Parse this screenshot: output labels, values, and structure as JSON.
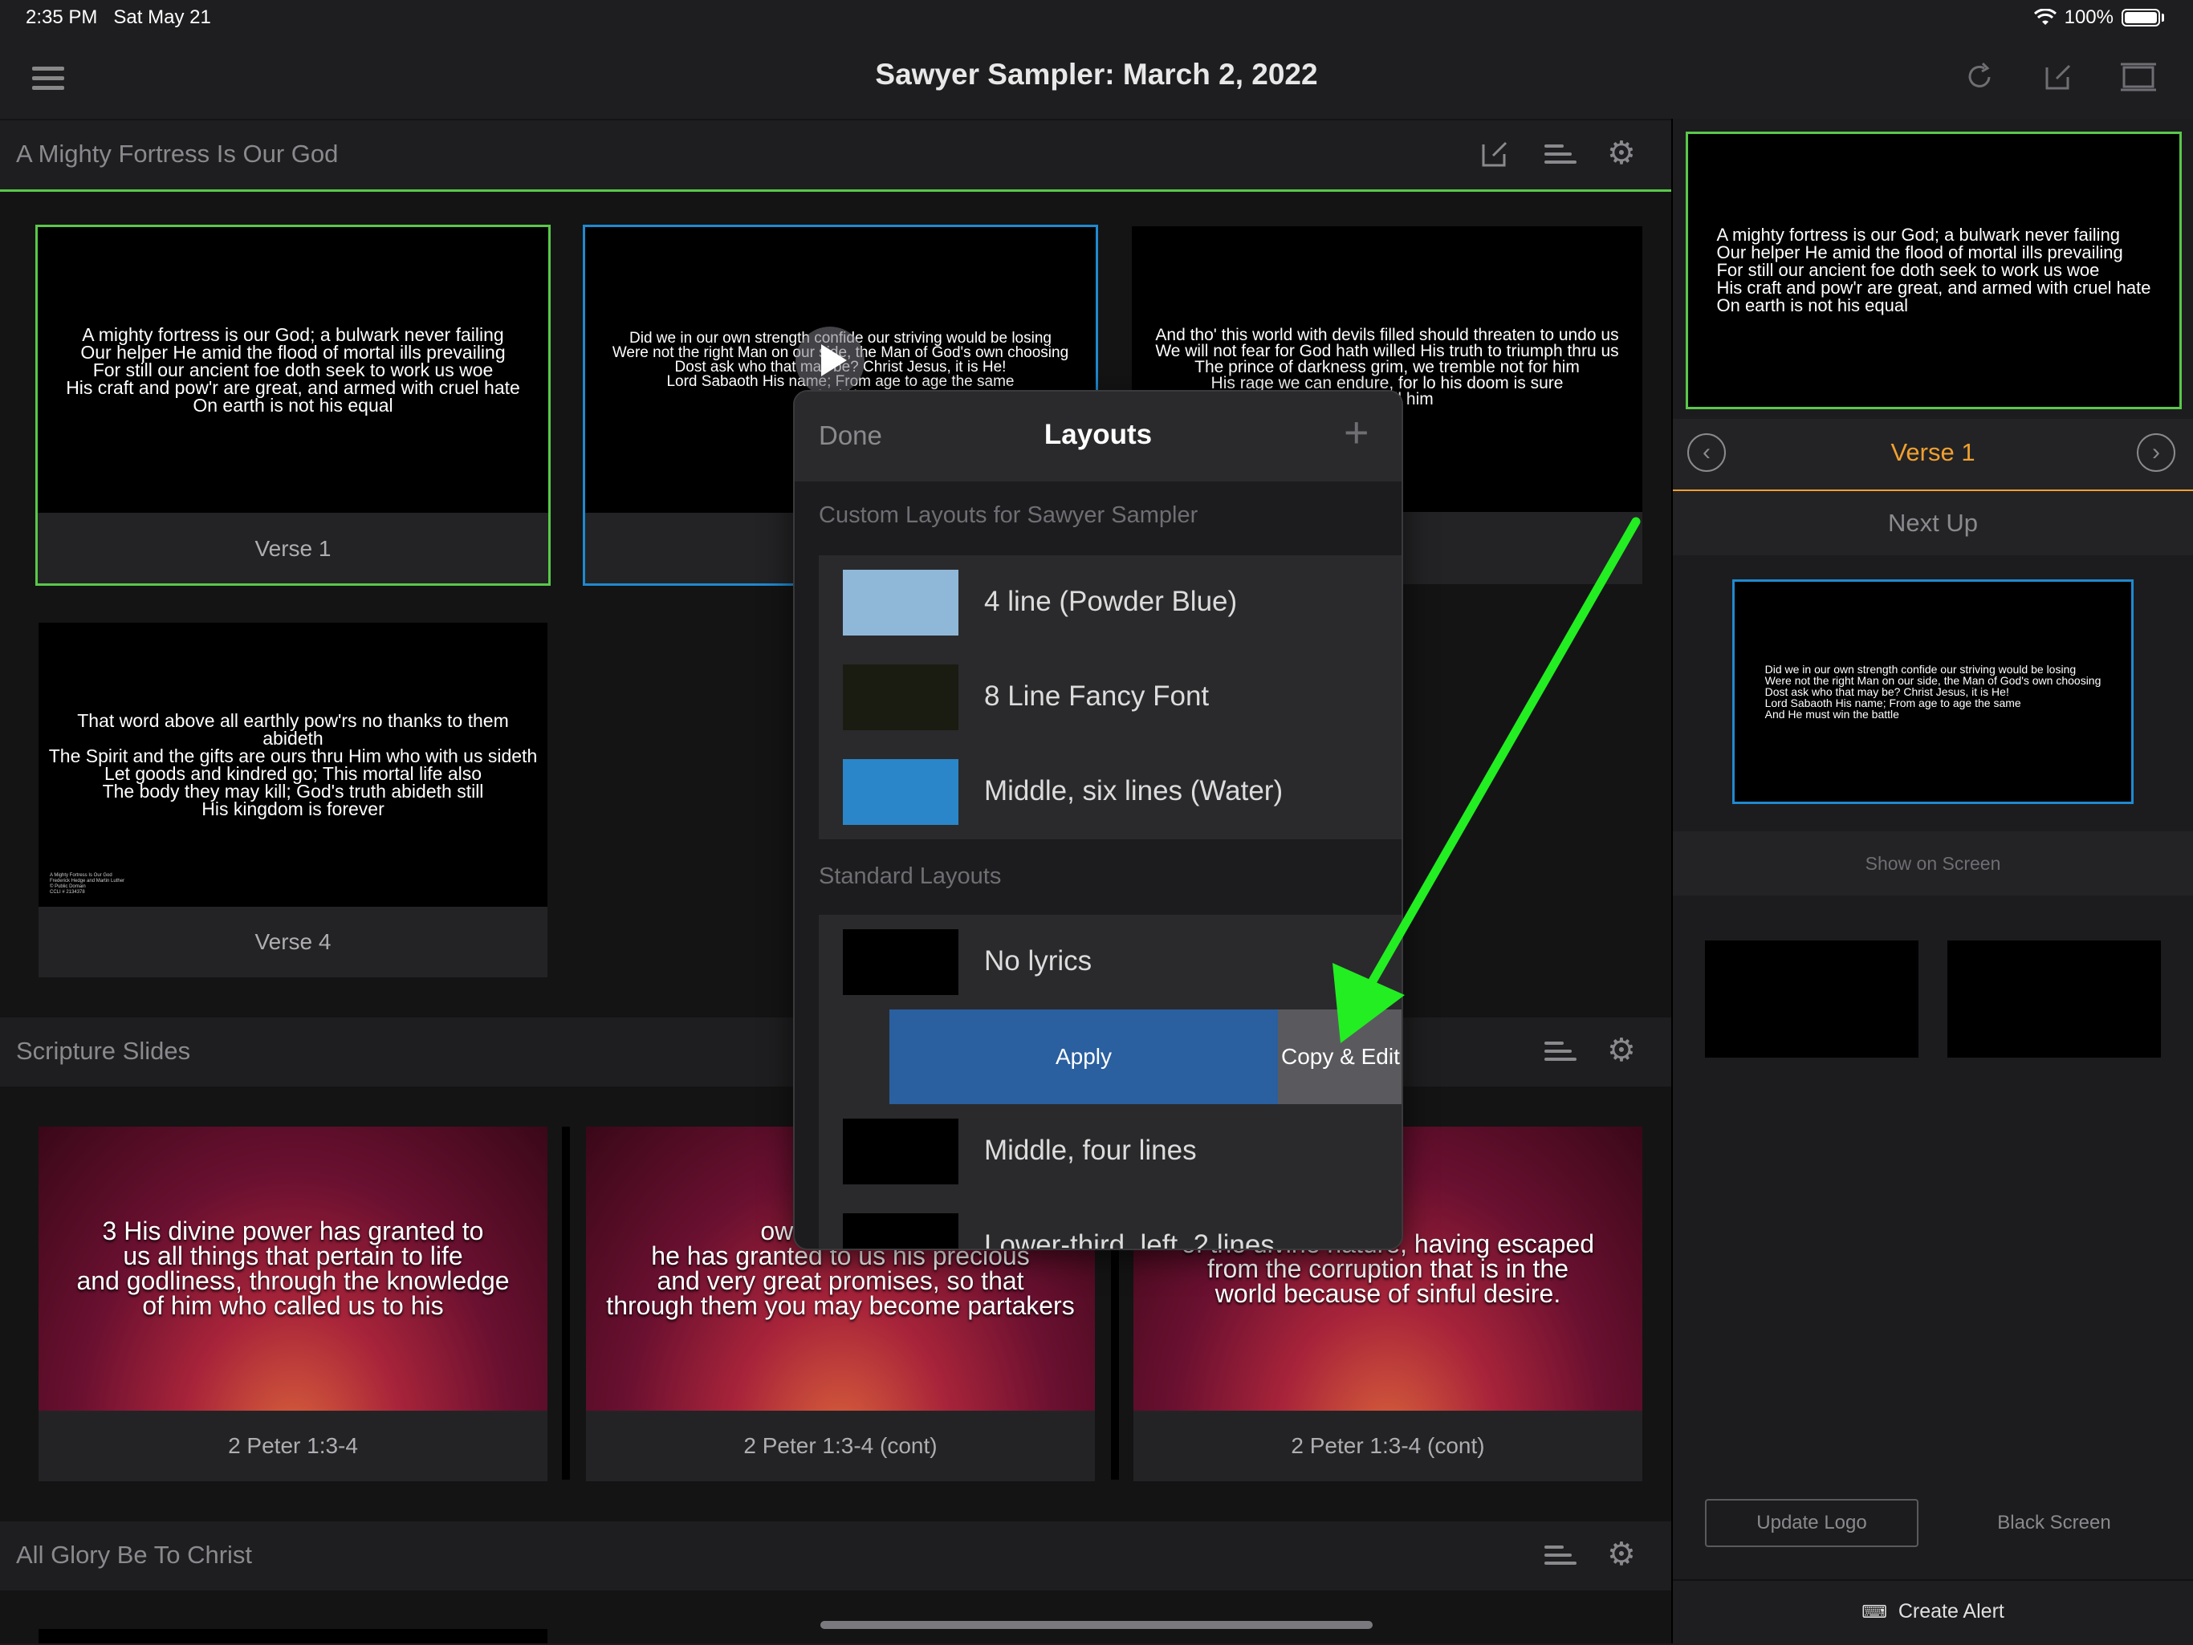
{
  "status_bar": {
    "time": "2:35 PM",
    "date": "Sat May 21",
    "battery": "100%"
  },
  "nav": {
    "title": "Sawyer Sampler: March 2, 2022",
    "icons": [
      "menu-icon",
      "refresh-icon",
      "edit-icon",
      "screen-icon"
    ]
  },
  "sections": [
    {
      "title": "A Mighty Fortress Is Our God"
    },
    {
      "title": "Scripture Slides"
    },
    {
      "title": "All Glory Be To Christ"
    }
  ],
  "fortress_slides": [
    {
      "label": "Verse 1",
      "lyrics": "A mighty fortress is our God; a bulwark never failing\nOur helper He amid the flood of mortal ills prevailing\nFor still our ancient foe doth seek to work us woe\nHis craft and pow'r are great, and armed with cruel hate\nOn earth is not his equal"
    },
    {
      "label": "",
      "lyrics": "Did we in our own strength confide our striving would be losing\nWere not the right Man on our side, the Man of God's own choosing\nDost ask who that may be? Christ Jesus, it is He!\nLord Sabaoth His name; From age to age the same\nAnd He"
    },
    {
      "label": "e 3",
      "lyrics": "And tho' this world with devils filled should threaten to undo us\nWe will not fear for God hath willed His truth to triumph thru us\nThe prince of darkness grim, we tremble not for him\nHis rage we can endure, for lo his doom is sure\nshall fell him"
    },
    {
      "label": "Verse 4",
      "lyrics": "That word above all earthly pow'rs no thanks to them abideth\nThe Spirit and the gifts are ours thru Him who with us sideth\nLet goods and kindred go; This mortal life also\nThe body they may kill; God's truth abideth still\nHis kingdom is forever",
      "footer": "A Mighty Fortress Is Our God\nFrederick Hedge and Martin Luther\n© Public Domain\nCCLI # 2134378"
    }
  ],
  "scripture_slides": [
    {
      "label": "2 Peter 1:3-4",
      "text": "3 His divine power has granted to\nus all things that pertain to life\nand godliness, through the knowledge\nof him who called us to his"
    },
    {
      "label": "2 Peter 1:3-4 (cont)",
      "text": "own glory and\nhe has granted to us his precious\nand very great promises, so that\nthrough them you may become partakers"
    },
    {
      "label": "2 Peter 1:3-4 (cont)",
      "text": "of the divine nature, having escaped\nfrom the corruption that is in the\nworld because of sinful desire."
    }
  ],
  "right_panel": {
    "current_lyrics": "A mighty fortress is our God; a bulwark never failing\nOur helper He amid the flood of mortal ills prevailing\nFor still our ancient foe doth seek to work us woe\nHis craft and pow'r are great, and armed with cruel hate\nOn earth is not his equal",
    "current_label": "Verse 1",
    "next_up_label": "Next Up",
    "next_lyrics": "Did we in our own strength confide our striving would be losing\nWere not the right Man on our side, the Man of God's own choosing\nDost ask who that may be? Christ Jesus, it is He!\nLord Sabaoth His name; From age to age the same\nAnd He must win the battle",
    "show_on_screen": "Show on Screen",
    "update_logo": "Update Logo",
    "black_screen": "Black Screen",
    "create_alert": "Create Alert"
  },
  "popover": {
    "done": "Done",
    "title": "Layouts",
    "add": "+",
    "custom_section": "Custom Layouts for Sawyer Sampler",
    "custom_layouts": [
      {
        "label": "4 line (Powder Blue)",
        "color": "#8fb8d8"
      },
      {
        "label": "8 Line Fancy Font",
        "color": "#1a1c12"
      },
      {
        "label": "Middle, six lines (Water)",
        "color": "#2a86c8"
      }
    ],
    "standard_section": "Standard Layouts",
    "standard_layouts": [
      {
        "label": "No lyrics"
      },
      {
        "label": "Middle, four lines"
      },
      {
        "label": "Lower-third, left, 2 lines"
      }
    ],
    "apply": "Apply",
    "copy_edit": "Copy & Edit"
  },
  "colors": {
    "accent_green": "#5ac84a",
    "accent_blue": "#1f8ad0",
    "accent_orange": "#f0a030",
    "arrow": "#22ee22",
    "apply_blue": "#2a5fa0"
  }
}
